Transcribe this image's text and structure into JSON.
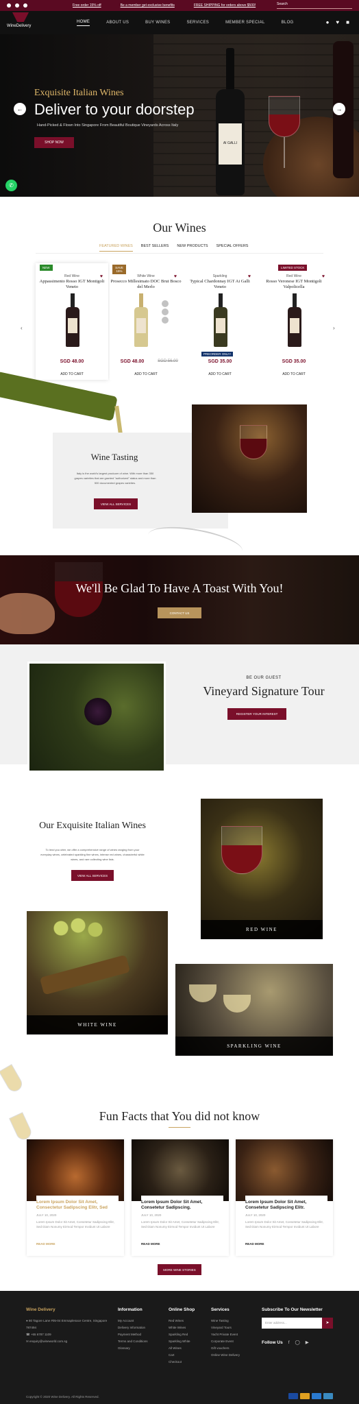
{
  "topbar": {
    "promos": [
      "Free order 15% off",
      "Be a member get exclusive benefits",
      "FREE SHIPPING for orders above $500!"
    ],
    "search_placeholder": "Search"
  },
  "nav": {
    "logo_text": "WineDelivery",
    "items": [
      "HOME",
      "ABOUT US",
      "BUY WINES",
      "SERVICES",
      "MEMBER SPECIAL",
      "BLOG"
    ],
    "active": "HOME"
  },
  "hero": {
    "subtitle": "Exquisite Italian Wines",
    "title": "Deliver to your doorstep",
    "description": "Hand-Picked & Flown Into Singapore From Beautiful Boutique Vineyards Across Italy",
    "button": "SHOP NOW",
    "bottle_label": "AI GALLI",
    "prev_icon": "chevron-left",
    "next_icon": "chevron-right"
  },
  "our_wines": {
    "title": "Our Wines",
    "tabs": [
      "FEATURED WINES",
      "BEST SELLERS",
      "NEW PRODUCTS",
      "SPECIAL OFFERS"
    ],
    "products": [
      {
        "badge": "NEW",
        "badge_color": "#2a8a2a",
        "category": "Red Wine",
        "name": "Appassimento Rosso IGT Montigoli Veneto",
        "price": "SGD 48.00",
        "old_price": "",
        "action": "ADD TO CART",
        "preorder": ""
      },
      {
        "badge": "SAVE 15%",
        "badge_color": "#9a6a2a",
        "category": "White Wine",
        "name": "Prosecco Millesimato DOC Brut Bosco del Merlo",
        "price": "SGD 48.00",
        "old_price": "SGD 56.00",
        "action": "ADD TO CART",
        "preorder": ""
      },
      {
        "badge": "",
        "badge_color": "",
        "category": "Sparkling",
        "name": "Typical Chardonnay IGT Ai Galli Veneto",
        "price": "SGD 35.00",
        "old_price": "",
        "action": "ADD TO CART",
        "preorder": "PREORDER ONLY!"
      },
      {
        "badge": "LIMITED STOCK",
        "badge_color": "#7a0f2a",
        "category": "Red Wine",
        "name": "Rosso Veronese IGT Montigoli Valpolicella",
        "price": "SGD 35.00",
        "old_price": "",
        "action": "ADD TO CART",
        "preorder": ""
      }
    ]
  },
  "wine_tasting": {
    "title": "Wine Tasting",
    "description": "Italy is the world's largest producer of wine. With more than 350 grapes varieties that are granted \"authorized\" status and more than 500 documented grapes varieties.",
    "button": "VIEW ALL SERVICES"
  },
  "toast": {
    "title": "We'll Be Glad To Have A Toast With You!",
    "button": "CONTACT US"
  },
  "vineyard": {
    "subtitle": "BE OUR GUEST",
    "title": "Vineyard Signature Tour",
    "button": "REGISTER YOUR INTEREST"
  },
  "exquisite": {
    "title": "Our Exquisite Italian Wines",
    "description": "To lend you utter, we offer a comprehensive range of wines ranging from your everyday wines, celebrated sparkling fine wines, intense red wines, characterful white wines, and rare collecting wine lists.",
    "button": "VIEW ALL SERVICES",
    "categories": [
      "RED WINE",
      "WHITE WINE",
      "SPARKLING WINE"
    ]
  },
  "fun_facts": {
    "title": "Fun Facts that You did not know",
    "posts": [
      {
        "title": "Lorem Ipsum Dolor Sit Amet, Consectetur Sadipscing Elitr, Sed",
        "date": "JULY 10, 2020",
        "excerpt": "Lorem Ipsum Dolor Sit Amet, Consetetur Sadipscing Elitr, Sed Diam Nonumy Eirmod Tempor Invidunt Ut Labore",
        "link": "READ MORE",
        "highlight": true
      },
      {
        "title": "Lorem Ipsum Dolor Sit Amet, Consetetur Sadipscing.",
        "date": "JULY 10, 2020",
        "excerpt": "Lorem Ipsum Dolor Sit Amet, Consetetur Sadipscing Elitr, Sed Diam Nonumy Eirmod Tempor Invidunt Ut Labore",
        "link": "READ MORE",
        "highlight": false
      },
      {
        "title": "Lorem Ipsum Dolor Sit Amet, Consetetur Sadipscing Elitr.",
        "date": "JULY 10, 2020",
        "excerpt": "Lorem Ipsum Dolor Sit Amet, Consetetur Sadipscing Elitr, Sed Diam Nonumy Eirmod Tempor Invidunt Ut Labore",
        "link": "READ MORE",
        "highlight": false
      }
    ],
    "button": "MORE WINE STORIES"
  },
  "footer": {
    "brand": "Wine Delivery",
    "address": "80 Tagore Lane #05-04 Emmaplenace Centre, Singapore 787494",
    "phone": "+65 6787 1109",
    "email": "enquiry@wineworld.com.sg",
    "columns": [
      {
        "title": "Information",
        "links": [
          "My Account",
          "Delivery Information",
          "Payment Method",
          "Terms and Conditions",
          "Glossary"
        ]
      },
      {
        "title": "Online Shop",
        "links": [
          "Red Wines",
          "White Wines",
          "Sparkling Red",
          "Sparkling White",
          "All Wines",
          "Cart",
          "Checkout"
        ]
      },
      {
        "title": "Services",
        "links": [
          "Wine Tasting",
          "Vineyard Tours",
          "Yacht Private Event",
          "Corporate Event",
          "Gift vouchers",
          "Online Wine Delivery"
        ]
      }
    ],
    "newsletter_title": "Subscribe To Our Newsletter",
    "newsletter_placeholder": "Enter address...",
    "follow": "Follow Us",
    "copyright": "Copyright © 2020 Wine Delivery. All Rights Reserved."
  }
}
